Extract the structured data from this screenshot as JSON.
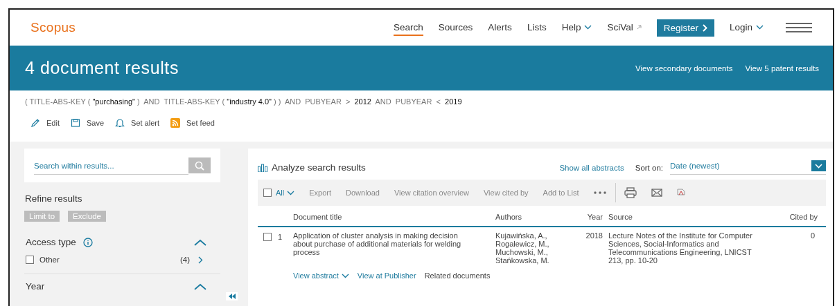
{
  "header": {
    "logo": "Scopus",
    "nav": [
      {
        "label": "Search",
        "selected": true,
        "kind": "link"
      },
      {
        "label": "Sources",
        "selected": false,
        "kind": "link"
      },
      {
        "label": "Alerts",
        "selected": false,
        "kind": "link"
      },
      {
        "label": "Lists",
        "selected": false,
        "kind": "link"
      },
      {
        "label": "Help",
        "selected": false,
        "kind": "menu"
      },
      {
        "label": "SciVal",
        "selected": false,
        "kind": "external"
      }
    ],
    "register": "Register",
    "login": "Login"
  },
  "banner": {
    "title": "4 document results",
    "links": [
      "View secondary documents",
      "View 5 patent results"
    ]
  },
  "query": "( TITLE-ABS-KEY ( **\"purchasing\"** )  AND  TITLE-ABS-KEY ( **\"industry 4.0\"** ) )  AND  PUBYEAR  >  **2012**  AND  PUBYEAR  <  **2019**",
  "query_actions": [
    {
      "label": "Edit",
      "kind": "edit"
    },
    {
      "label": "Save",
      "kind": "save"
    },
    {
      "label": "Set alert",
      "kind": "alert"
    },
    {
      "label": "Set feed",
      "kind": "feed"
    }
  ],
  "sidebar": {
    "search": {
      "placeholder": "Search within results..."
    },
    "refine_title": "Refine results",
    "buttons": [
      "Limit to",
      "Exclude"
    ],
    "facets": [
      {
        "title": "Access type",
        "info": true,
        "expanded": true,
        "options": [
          {
            "label": "Other",
            "count": "(4)",
            "checked": false
          }
        ]
      },
      {
        "title": "Year",
        "info": false,
        "expanded": true
      }
    ]
  },
  "results": {
    "analyze": "Analyze search results",
    "show_abstracts": "Show all abstracts",
    "sort_label": "Sort on:",
    "sort_value": "Date (newest)",
    "select_all": {
      "label": "All",
      "checked": false
    },
    "toolbar": [
      "Export",
      "Download",
      "View citation overview",
      "View cited by",
      "Add to List"
    ],
    "columns": [
      "Document title",
      "Authors",
      "Year",
      "Source",
      "Cited by"
    ],
    "rows": [
      {
        "number": "1",
        "checked": false,
        "title": "Application of cluster analysis in making decision about purchase of additional materials for welding process",
        "authors": [
          "Kujawińska, A.,",
          "Rogalewicz, M.,",
          "Muchowski, M.,",
          "Stańkowska, M."
        ],
        "year": "2018",
        "source": [
          "Lecture Notes of the Institute for Computer Sciences, Social-Informatics and Telecommunications Engineering, LNICST",
          "213, pp. 10-20"
        ],
        "cited_by": "0",
        "links": [
          {
            "label": "View abstract",
            "kind": "toggle"
          },
          {
            "label": "View at Publisher",
            "kind": "link"
          },
          {
            "label": "Related documents",
            "kind": "plain"
          }
        ]
      }
    ]
  }
}
